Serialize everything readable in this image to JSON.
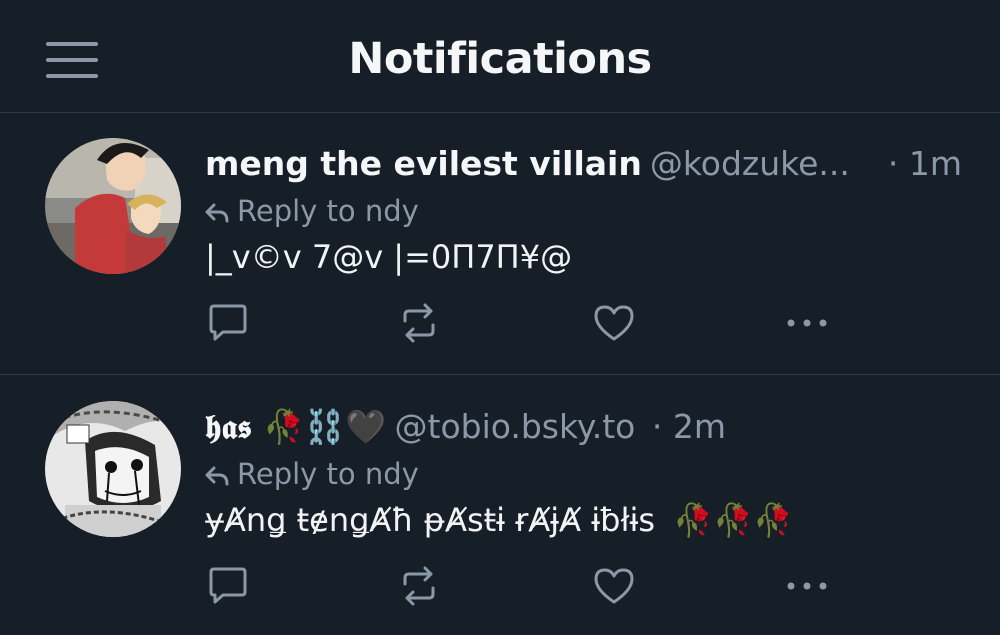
{
  "header": {
    "title": "Notifications",
    "menu_icon": "hamburger-menu-icon"
  },
  "notifications": [
    {
      "author_name": "meng the evilest villain",
      "author_handle": "@kodzuke...",
      "time": "· 1m",
      "reply_prefix": "Reply to",
      "reply_target": "ndy",
      "text": "|_v©v 7@v |=0Π7Π¥@"
    },
    {
      "author_name": "𝖍𝖆𝖘",
      "author_name_emoji": "🥀⛓️🖤",
      "author_handle": "@tobio.bsky.to",
      "time": "· 2m",
      "reply_prefix": "Reply to",
      "reply_target": "ndy",
      "text": "ɏȺnǥ ŧɇnǥȺħ ᵽȺsŧɨ ɍȺɉȺ ɨƀłɨs",
      "text_emoji": "🥀🥀🥀"
    }
  ],
  "colors": {
    "background": "#161e27",
    "divider": "#2c3a4a",
    "muted": "#8b98a8",
    "text": "#f1f3f5"
  }
}
